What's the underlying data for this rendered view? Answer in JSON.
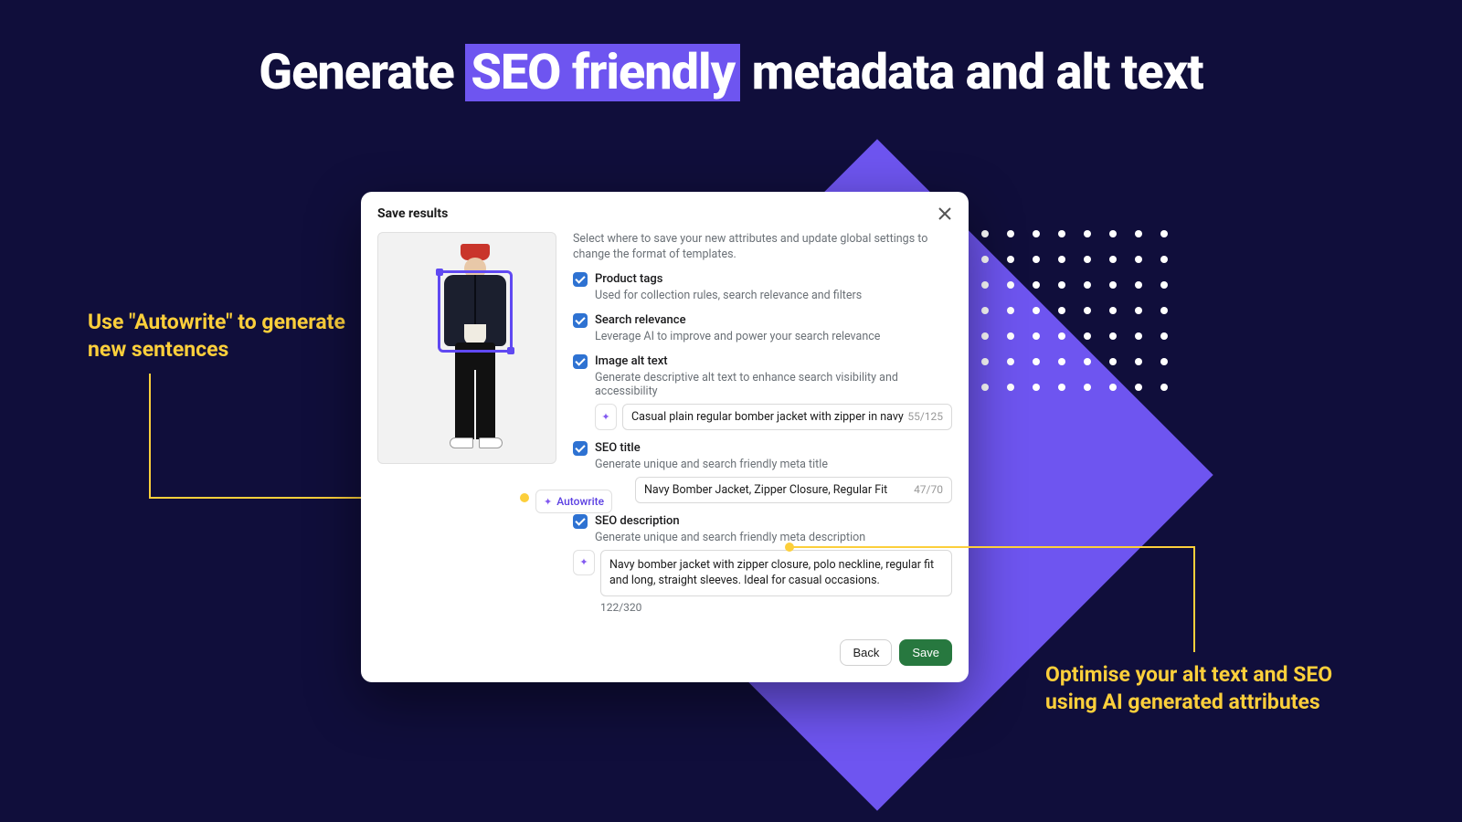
{
  "hero": {
    "pre": "Generate ",
    "highlight": "SEO friendly",
    "post": " metadata and alt text"
  },
  "callouts": {
    "left": "Use \"Autowrite\" to generate new sentences",
    "right": "Optimise your alt text and SEO using AI generated attributes"
  },
  "card": {
    "title": "Save results",
    "intro": "Select where to save your new attributes and update global settings to change the format of templates.",
    "autowrite_label": "Autowrite",
    "options": {
      "product_tags": {
        "label": "Product tags",
        "desc": "Used for collection rules, search relevance and filters"
      },
      "search_relevance": {
        "label": "Search relevance",
        "desc": "Leverage AI to improve and power your search relevance"
      },
      "image_alt": {
        "label": "Image alt text",
        "desc": "Generate descriptive alt text to enhance search visibility and accessibility",
        "value": "Casual plain regular bomber jacket with zipper in navy",
        "count": "55/125"
      },
      "seo_title": {
        "label": "SEO title",
        "desc": "Generate unique and search friendly meta title",
        "value": "Navy Bomber Jacket, Zipper Closure, Regular Fit",
        "count": "47/70"
      },
      "seo_description": {
        "label": "SEO description",
        "desc": "Generate unique and search friendly meta description",
        "value": "Navy bomber jacket with zipper closure, polo neckline, regular fit and long, straight sleeves. Ideal for casual occasions.",
        "count": "122/320"
      }
    },
    "buttons": {
      "back": "Back",
      "save": "Save"
    }
  }
}
